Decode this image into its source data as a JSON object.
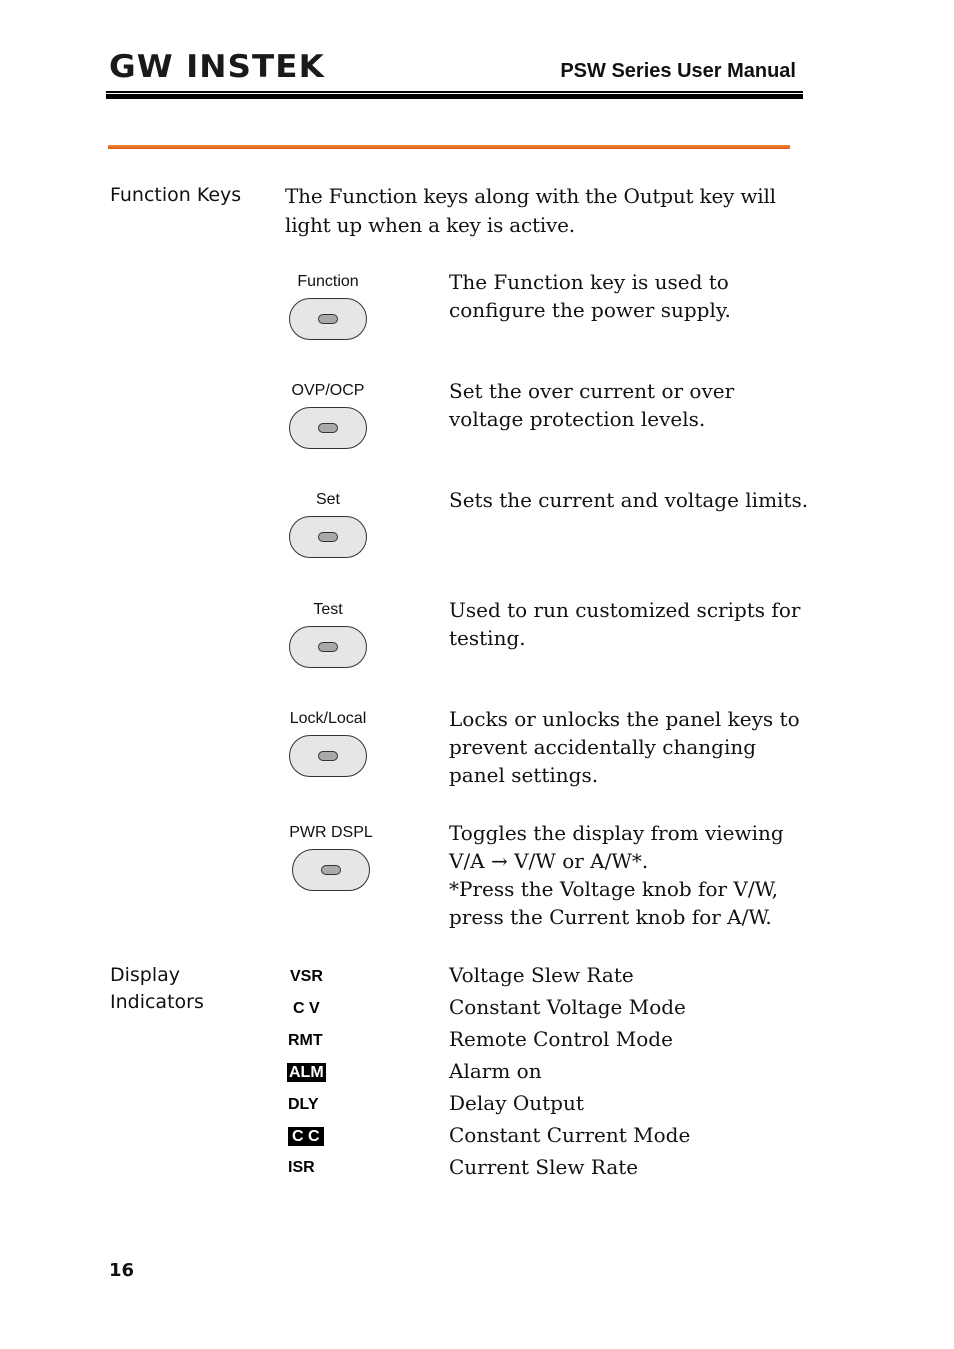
{
  "header": {
    "logo": "GW INSTEK",
    "manual_title": "PSW Series User Manual"
  },
  "function_keys": {
    "section_label": "Function Keys",
    "intro_line1": "The Function keys along with the Output key will",
    "intro_line2": "light up when a key is active.",
    "keys": [
      {
        "label": "Function",
        "desc": [
          "The Function key is used to",
          "configure the power supply."
        ]
      },
      {
        "label": "OVP/OCP",
        "desc": [
          "Set the over current or over",
          "voltage protection levels."
        ]
      },
      {
        "label": "Set",
        "desc": [
          "Sets the current and voltage limits."
        ]
      },
      {
        "label": "Test",
        "desc": [
          "Used to run customized scripts for",
          "testing."
        ]
      },
      {
        "label": "Lock/Local",
        "desc": [
          "Locks or unlocks the panel keys to",
          "prevent accidentally changing",
          "panel settings."
        ]
      },
      {
        "label": "PWR DSPL",
        "desc": [
          "Toggles the display from viewing",
          "V/A → V/W or A/W*.",
          "*Press the Voltage knob for V/W,",
          "press the Current knob for A/W."
        ]
      }
    ]
  },
  "display_indicators": {
    "section_label_line1": "Display",
    "section_label_line2": "Indicators",
    "items": [
      {
        "code": "VSR",
        "inverted": false,
        "desc": "Voltage Slew Rate"
      },
      {
        "code": "C V",
        "inverted": false,
        "desc": "Constant Voltage Mode"
      },
      {
        "code": "RMT",
        "inverted": false,
        "desc": "Remote Control Mode"
      },
      {
        "code": "ALM",
        "inverted": true,
        "desc": "Alarm on"
      },
      {
        "code": "DLY",
        "inverted": false,
        "desc": "Delay Output"
      },
      {
        "code": "C C",
        "inverted": true,
        "desc": "Constant Current Mode"
      },
      {
        "code": "ISR",
        "inverted": false,
        "desc": "Current Slew Rate"
      }
    ]
  },
  "footer": {
    "page_number": "16"
  }
}
